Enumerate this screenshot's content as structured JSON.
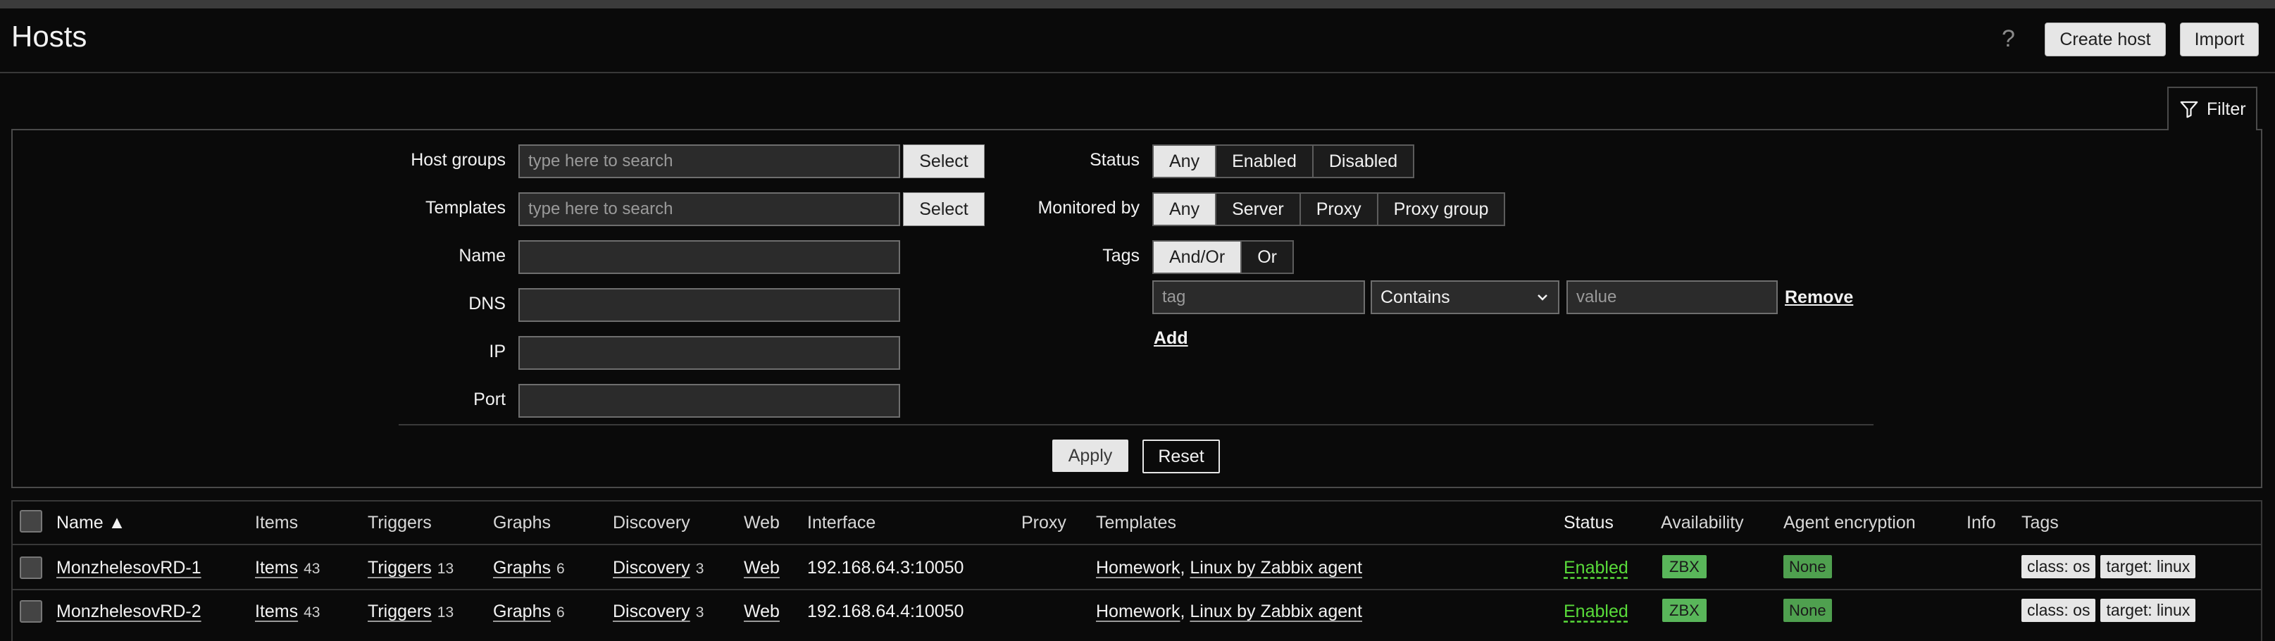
{
  "header": {
    "title": "Hosts",
    "help": "?",
    "create_host": "Create host",
    "import": "Import"
  },
  "filter": {
    "tab_label": "Filter",
    "host_groups": {
      "label": "Host groups",
      "placeholder": "type here to search",
      "button": "Select"
    },
    "templates": {
      "label": "Templates",
      "placeholder": "type here to search",
      "button": "Select"
    },
    "name_label": "Name",
    "dns_label": "DNS",
    "ip_label": "IP",
    "port_label": "Port",
    "status": {
      "label": "Status",
      "options": [
        "Any",
        "Enabled",
        "Disabled"
      ],
      "selected": "Any"
    },
    "monitored_by": {
      "label": "Monitored by",
      "options": [
        "Any",
        "Server",
        "Proxy",
        "Proxy group"
      ],
      "selected": "Any"
    },
    "tags": {
      "label": "Tags",
      "options": [
        "And/Or",
        "Or"
      ],
      "selected": "And/Or",
      "tag_placeholder": "tag",
      "operator": "Contains",
      "value_placeholder": "value",
      "remove": "Remove",
      "add": "Add"
    },
    "apply": "Apply",
    "reset": "Reset"
  },
  "table": {
    "columns": {
      "name": "Name ▲",
      "items": "Items",
      "triggers": "Triggers",
      "graphs": "Graphs",
      "discovery": "Discovery",
      "web": "Web",
      "interface": "Interface",
      "proxy": "Proxy",
      "templates": "Templates",
      "status": "Status",
      "availability": "Availability",
      "agent_encryption": "Agent encryption",
      "info": "Info",
      "tags": "Tags"
    },
    "rows": [
      {
        "name": "MonzhelesovRD-1",
        "items": "Items",
        "items_count": "43",
        "triggers": "Triggers",
        "triggers_count": "13",
        "graphs": "Graphs",
        "graphs_count": "6",
        "discovery": "Discovery",
        "discovery_count": "3",
        "web": "Web",
        "interface": "192.168.64.3:10050",
        "template1": "Homework",
        "template_sep": ",",
        "template2": "Linux by Zabbix agent",
        "status": "Enabled",
        "availability": "ZBX",
        "encryption": "None",
        "tag1": "class: os",
        "tag2": "target: linux"
      },
      {
        "name": "MonzhelesovRD-2",
        "items": "Items",
        "items_count": "43",
        "triggers": "Triggers",
        "triggers_count": "13",
        "graphs": "Graphs",
        "graphs_count": "6",
        "discovery": "Discovery",
        "discovery_count": "3",
        "web": "Web",
        "interface": "192.168.64.4:10050",
        "template1": "Homework",
        "template_sep": ",",
        "template2": "Linux by Zabbix agent",
        "status": "Enabled",
        "availability": "ZBX",
        "encryption": "None",
        "tag1": "class: os",
        "tag2": "target: linux"
      }
    ]
  }
}
